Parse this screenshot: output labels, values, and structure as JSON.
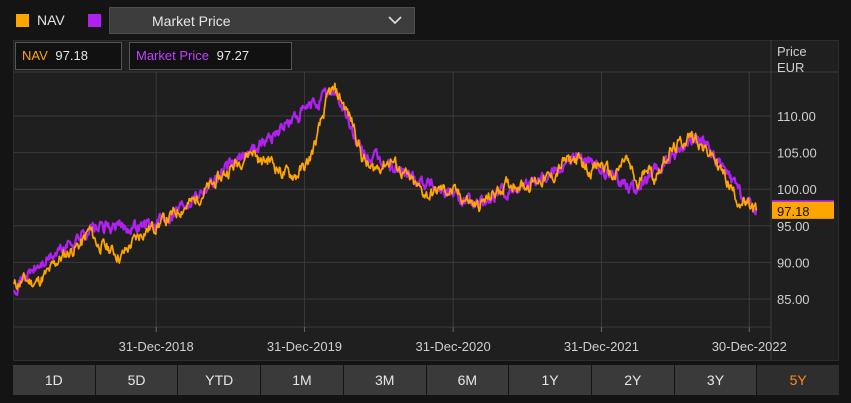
{
  "legend": {
    "nav": {
      "label": "NAV",
      "color": "#ffa500"
    },
    "market": {
      "color": "#b020f0"
    },
    "dropdown_label": "Market Price"
  },
  "values": {
    "nav_label": "NAV",
    "nav_value": "97.18",
    "market_label": "Market Price",
    "market_value": "97.27"
  },
  "axis": {
    "title_line1": "Price",
    "title_line2": "EUR"
  },
  "ranges": [
    "1D",
    "5D",
    "YTD",
    "1M",
    "3M",
    "6M",
    "1Y",
    "2Y",
    "3Y",
    "5Y"
  ],
  "active_range": "5Y",
  "chart_data": {
    "type": "line",
    "ylabel": "Price EUR",
    "ylim": [
      81.5,
      116.5
    ],
    "xlim": [
      "2018-01-15",
      "2023-01-18"
    ],
    "yticks": [
      85,
      90,
      95,
      100,
      105,
      110
    ],
    "ytick_labels": [
      "85.00",
      "90.00",
      "95.00",
      "100.00",
      "105.00",
      "110.00"
    ],
    "xticks": [
      "2018-12-31",
      "2019-12-31",
      "2020-12-31",
      "2021-12-31",
      "2022-12-30"
    ],
    "xtick_labels": [
      "31-Dec-2018",
      "31-Dec-2019",
      "31-Dec-2020",
      "31-Dec-2021",
      "30-Dec-2022"
    ],
    "grid": true,
    "legend_position": "top-left",
    "last_labels": {
      "market": "97.27",
      "nav": "97.18"
    },
    "series": [
      {
        "name": "NAV",
        "color": "#ffa500",
        "points": [
          [
            "2018-01-15",
            86.8
          ],
          [
            "2018-02-10",
            87.6
          ],
          [
            "2018-03-10",
            87.2
          ],
          [
            "2018-04-10",
            88.6
          ],
          [
            "2018-05-01",
            90.2
          ],
          [
            "2018-06-01",
            91.5
          ],
          [
            "2018-07-01",
            92.6
          ],
          [
            "2018-07-20",
            94.5
          ],
          [
            "2018-08-10",
            92.4
          ],
          [
            "2018-09-10",
            91.8
          ],
          [
            "2018-10-05",
            90.7
          ],
          [
            "2018-11-01",
            92.6
          ],
          [
            "2018-12-01",
            94.3
          ],
          [
            "2019-01-01",
            95.1
          ],
          [
            "2019-02-01",
            96.1
          ],
          [
            "2019-03-01",
            97.3
          ],
          [
            "2019-04-01",
            98.3
          ],
          [
            "2019-05-01",
            99.8
          ],
          [
            "2019-06-01",
            101.2
          ],
          [
            "2019-07-01",
            102.8
          ],
          [
            "2019-08-10",
            104.7
          ],
          [
            "2019-08-25",
            105.4
          ],
          [
            "2019-09-15",
            103.6
          ],
          [
            "2019-10-05",
            104.2
          ],
          [
            "2019-11-05",
            102.3
          ],
          [
            "2019-12-10",
            101.9
          ],
          [
            "2020-01-10",
            103.6
          ],
          [
            "2020-02-01",
            107.2
          ],
          [
            "2020-02-20",
            111.1
          ],
          [
            "2020-03-01",
            113.1
          ],
          [
            "2020-03-15",
            113.4
          ],
          [
            "2020-04-01",
            112.1
          ],
          [
            "2020-05-01",
            108.6
          ],
          [
            "2020-05-20",
            104.6
          ],
          [
            "2020-06-10",
            102.6
          ],
          [
            "2020-07-01",
            103.1
          ],
          [
            "2020-08-01",
            104.0
          ],
          [
            "2020-09-01",
            102.1
          ],
          [
            "2020-10-01",
            100.3
          ],
          [
            "2020-11-01",
            99.1
          ],
          [
            "2020-12-01",
            100.0
          ],
          [
            "2021-01-01",
            99.6
          ],
          [
            "2021-02-01",
            98.6
          ],
          [
            "2021-03-01",
            97.6
          ],
          [
            "2021-04-01",
            98.9
          ],
          [
            "2021-05-01",
            100.3
          ],
          [
            "2021-06-01",
            100.9
          ],
          [
            "2021-07-01",
            100.5
          ],
          [
            "2021-08-01",
            101.4
          ],
          [
            "2021-09-01",
            101.5
          ],
          [
            "2021-10-01",
            103.8
          ],
          [
            "2021-11-01",
            104.1
          ],
          [
            "2021-12-01",
            102.6
          ],
          [
            "2022-01-01",
            103.4
          ],
          [
            "2022-02-01",
            101.5
          ],
          [
            "2022-03-01",
            104.3
          ],
          [
            "2022-04-01",
            100.1
          ],
          [
            "2022-04-20",
            103.6
          ],
          [
            "2022-05-10",
            101.5
          ],
          [
            "2022-06-10",
            104.6
          ],
          [
            "2022-07-01",
            105.6
          ],
          [
            "2022-08-01",
            107.1
          ],
          [
            "2022-08-20",
            107.3
          ],
          [
            "2022-09-10",
            105.4
          ],
          [
            "2022-10-01",
            104.6
          ],
          [
            "2022-11-01",
            101.6
          ],
          [
            "2022-12-01",
            98.7
          ],
          [
            "2022-12-30",
            97.5
          ],
          [
            "2023-01-18",
            97.18
          ]
        ]
      },
      {
        "name": "Market Price",
        "color": "#b020f0",
        "points": [
          [
            "2018-01-15",
            86.9
          ],
          [
            "2018-07-20",
            94.6
          ],
          [
            "2019-01-01",
            95.2
          ],
          [
            "2019-08-25",
            105.5
          ],
          [
            "2020-03-15",
            113.6
          ],
          [
            "2020-05-20",
            104.8
          ],
          [
            "2020-12-01",
            100.1
          ],
          [
            "2021-03-01",
            97.7
          ],
          [
            "2021-11-01",
            104.3
          ],
          [
            "2022-04-01",
            100.0
          ],
          [
            "2022-08-20",
            107.4
          ],
          [
            "2022-10-01",
            104.7
          ],
          [
            "2022-12-30",
            97.6
          ],
          [
            "2023-01-18",
            97.27
          ]
        ]
      }
    ]
  }
}
